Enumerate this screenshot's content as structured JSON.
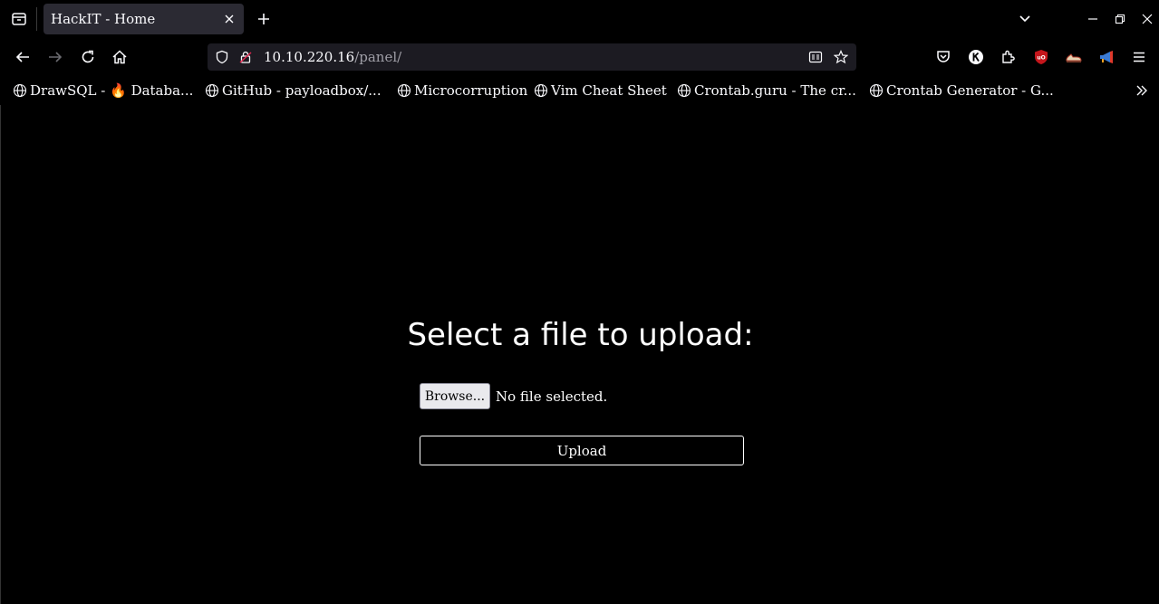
{
  "window": {
    "tab_title": "HackIT - Home"
  },
  "navigation": {
    "url_host": "10.10.220.16",
    "url_path": "/panel/"
  },
  "extensions": [
    "pocket-icon",
    "k-extension-icon",
    "extensions-icon",
    "ublock-icon",
    "sneaker-extension-icon",
    "megaphone-extension-icon"
  ],
  "bookmarks": [
    {
      "label": "DrawSQL - 🔥 Databa..."
    },
    {
      "label": "GitHub - payloadbox/..."
    },
    {
      "label": "Microcorruption"
    },
    {
      "label": "Vim Cheat Sheet"
    },
    {
      "label": "Crontab.guru - The cr..."
    },
    {
      "label": "Crontab Generator - G..."
    }
  ],
  "page": {
    "heading": "Select a file to upload:",
    "browse_label": "Browse...",
    "file_status": "No file selected.",
    "upload_label": "Upload"
  },
  "colors": {
    "background": "#000000",
    "tab_active": "#2b2a33",
    "urlbar": "#1c1b22",
    "ublock_red": "#c4161c"
  }
}
